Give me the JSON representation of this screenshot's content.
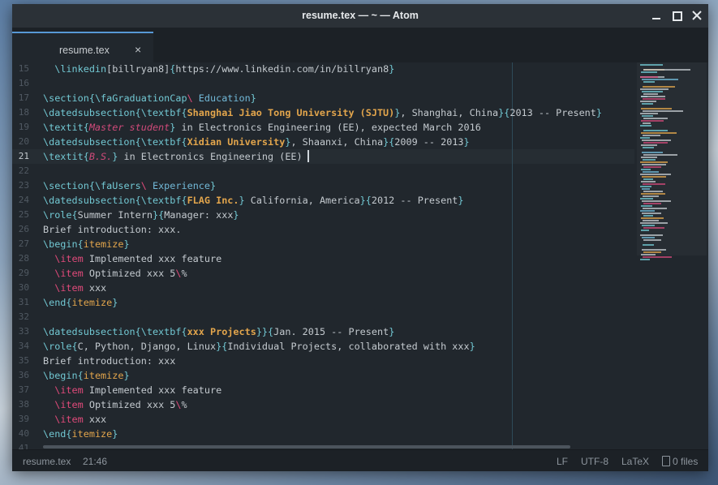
{
  "window": {
    "title": "resume.tex — ~ — Atom"
  },
  "tab": {
    "label": "resume.tex",
    "close_glyph": "×"
  },
  "editor": {
    "lines": [
      {
        "num": "15",
        "text": "  \\linkedin[billryan8]{https://www.linkedin.com/in/billryan8}"
      },
      {
        "num": "16",
        "text": ""
      },
      {
        "num": "17",
        "text": "\\section{\\faGraduationCap\\ Education}"
      },
      {
        "num": "18",
        "text": "\\datedsubsection{\\textbf{Shanghai Jiao Tong University (SJTU)}, Shanghai, China}{2013 -- Present}"
      },
      {
        "num": "19",
        "text": "\\textit{Master student} in Electronics Engineering (EE), expected March 2016"
      },
      {
        "num": "20",
        "text": "\\datedsubsection{\\textbf{Xidian University}, Shaanxi, China}{2009 -- 2013}"
      },
      {
        "num": "21",
        "text": "\\textit{B.S.} in Electronics Engineering (EE)"
      },
      {
        "num": "22",
        "text": ""
      },
      {
        "num": "23",
        "text": "\\section{\\faUsers\\ Experience}"
      },
      {
        "num": "24",
        "text": "\\datedsubsection{\\textbf{FLAG Inc.} California, America}{2012 -- Present}"
      },
      {
        "num": "25",
        "text": "\\role{Summer Intern}{Manager: xxx}"
      },
      {
        "num": "26",
        "text": "Brief introduction: xxx."
      },
      {
        "num": "27",
        "text": "\\begin{itemize}"
      },
      {
        "num": "28",
        "text": "  \\item Implemented xxx feature"
      },
      {
        "num": "29",
        "text": "  \\item Optimized xxx 5\\%"
      },
      {
        "num": "30",
        "text": "  \\item xxx"
      },
      {
        "num": "31",
        "text": "\\end{itemize}"
      },
      {
        "num": "32",
        "text": ""
      },
      {
        "num": "33",
        "text": "\\datedsubsection{\\textbf{xxx Projects}}{Jan. 2015 -- Present}"
      },
      {
        "num": "34",
        "text": "\\role{C, Python, Django, Linux}{Individual Projects, collaborated with xxx}"
      },
      {
        "num": "35",
        "text": "Brief introduction: xxx"
      },
      {
        "num": "36",
        "text": "\\begin{itemize}"
      },
      {
        "num": "37",
        "text": "  \\item Implemented xxx feature"
      },
      {
        "num": "38",
        "text": "  \\item Optimized xxx 5\\%"
      },
      {
        "num": "39",
        "text": "  \\item xxx"
      },
      {
        "num": "40",
        "text": "\\end{itemize}"
      },
      {
        "num": "41",
        "text": ""
      }
    ],
    "active_line": "21"
  },
  "status": {
    "filename": "resume.tex",
    "cursor": "21:46",
    "line_ending": "LF",
    "encoding": "UTF-8",
    "grammar": "LaTeX",
    "git": "0 files"
  },
  "colors": {
    "accent": "#5799d6",
    "command": "#72c8d3",
    "backslash": "#e04a7a",
    "bold_text": "#e2a54c",
    "italic_text": "#d04a7a",
    "background": "#21272d"
  },
  "icons": [
    "minimize-icon",
    "maximize-icon",
    "close-icon",
    "tab-close-icon",
    "file-icon"
  ]
}
